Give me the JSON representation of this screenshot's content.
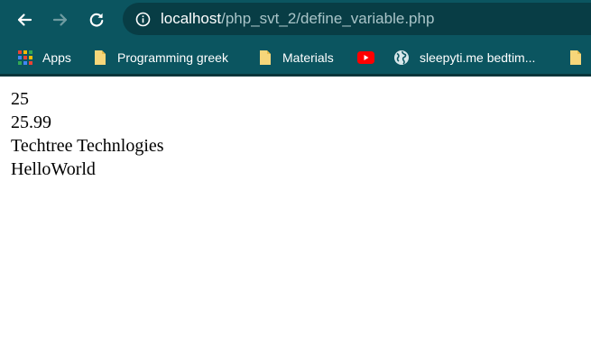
{
  "browser": {
    "url_host": "localhost",
    "url_path": "/php_svt_2/define_variable.php",
    "theme_color": "#0b5560",
    "icons": [
      "back-arrow-icon",
      "forward-arrow-icon",
      "reload-icon",
      "info-icon"
    ]
  },
  "bookmarks": {
    "items": [
      {
        "label": "Apps",
        "icon": "apps-grid-icon"
      },
      {
        "label": "Programming greek",
        "icon": "folder-icon"
      },
      {
        "label": "Materials",
        "icon": "folder-icon"
      },
      {
        "label": "",
        "icon": "youtube-icon"
      },
      {
        "label": "sleepyti.me bedtim...",
        "icon": "globe-icon"
      },
      {
        "label": "",
        "icon": "folder-icon"
      }
    ]
  },
  "page": {
    "lines": [
      "25",
      "25.99",
      "Techtree Technlogies",
      "HelloWorld"
    ]
  }
}
